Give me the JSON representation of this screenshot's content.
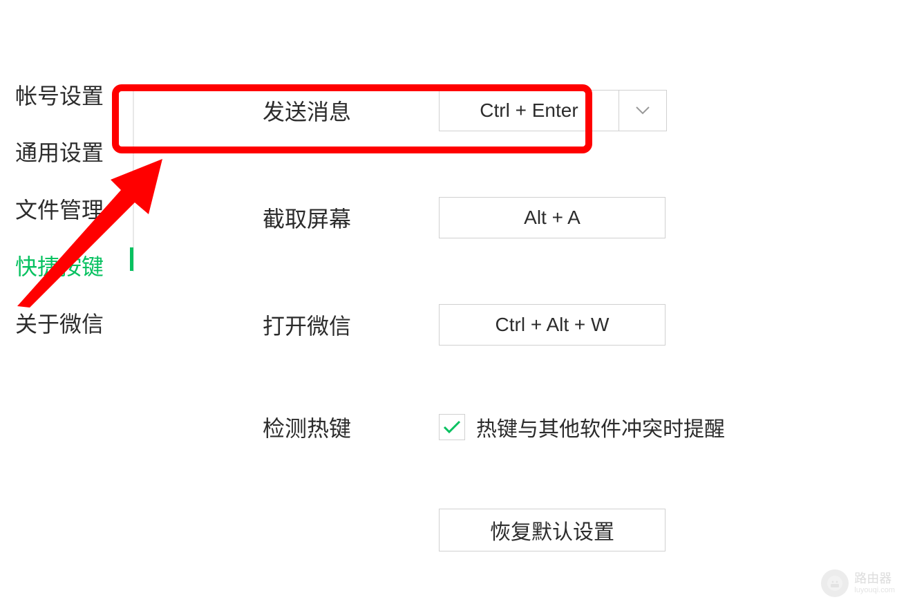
{
  "sidebar": {
    "items": [
      {
        "label": "帐号设置"
      },
      {
        "label": "通用设置"
      },
      {
        "label": "文件管理"
      },
      {
        "label": "快捷按键"
      },
      {
        "label": "关于微信"
      }
    ],
    "active_index": 3
  },
  "settings": {
    "send_message": {
      "label": "发送消息",
      "value": "Ctrl + Enter"
    },
    "screenshot": {
      "label": "截取屏幕",
      "value": "Alt + A"
    },
    "open_wechat": {
      "label": "打开微信",
      "value": "Ctrl + Alt + W"
    },
    "detect_hotkey": {
      "label": "检测热键",
      "checkbox_label": "热键与其他软件冲突时提醒",
      "checked": true
    },
    "restore_button": "恢复默认设置"
  },
  "colors": {
    "accent": "#07c160",
    "highlight": "#ff0000"
  },
  "watermark": {
    "title": "路由器",
    "sub": "luyouqi.com"
  }
}
